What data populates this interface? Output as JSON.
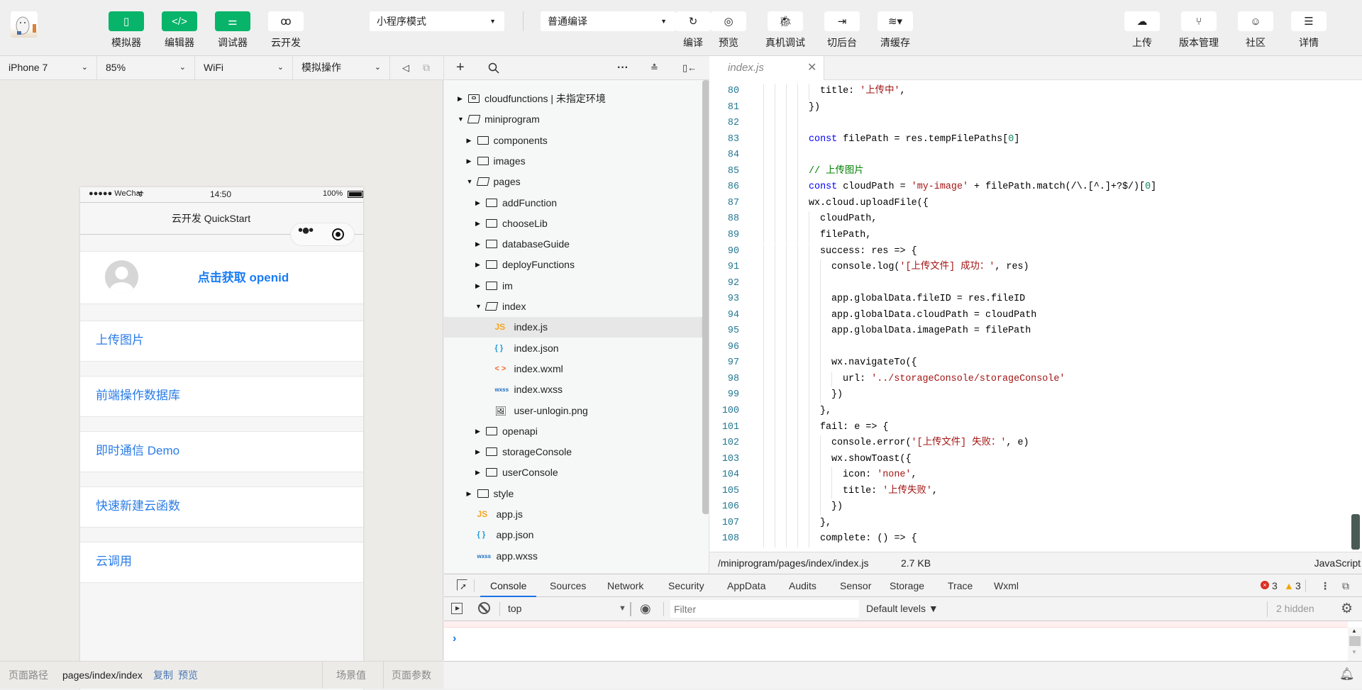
{
  "toolbar": {
    "left_buttons": [
      {
        "label": "模拟器",
        "icon": "phone-icon"
      },
      {
        "label": "编辑器",
        "icon": "code-icon"
      },
      {
        "label": "调试器",
        "icon": "debug-sliders-icon"
      },
      {
        "label": "云开发",
        "icon": "cloud-link-icon"
      }
    ],
    "mode_select": "小程序模式",
    "compile_select": "普通编译",
    "mid_buttons": [
      {
        "label": "编译",
        "icon": "refresh-icon"
      },
      {
        "label": "预览",
        "icon": "eye-icon"
      },
      {
        "label": "真机调试",
        "icon": "bug-icon"
      },
      {
        "label": "切后台",
        "icon": "switch-background-icon"
      },
      {
        "label": "清缓存",
        "icon": "layers-icon"
      }
    ],
    "right_buttons": [
      {
        "label": "上传",
        "icon": "cloud-upload-icon"
      },
      {
        "label": "版本管理",
        "icon": "branch-icon"
      },
      {
        "label": "社区",
        "icon": "chat-icon"
      },
      {
        "label": "详情",
        "icon": "menu-icon"
      }
    ],
    "accent_color": "#07b46a"
  },
  "simulator": {
    "device": "iPhone 7",
    "zoom": "85%",
    "network": "WiFi",
    "operation": "模拟操作",
    "phone": {
      "carrier": "●●●●● WeChat",
      "time": "14:50",
      "battery": "100%",
      "nav_title": "云开发 QuickStart",
      "openid_button": "点击获取 openid",
      "items": [
        "上传图片",
        "前端操作数据库",
        "即时通信 Demo",
        "快速新建云函数",
        "云调用"
      ],
      "link_color": "#2a7ce8"
    },
    "status": {
      "path_label": "页面路径",
      "path": "pages/index/index",
      "copy": "复制",
      "preview": "预览",
      "scene": "场景值",
      "params": "页面参数"
    }
  },
  "tree": [
    {
      "label": "cloudfunctions | 未指定环境",
      "depth": 0,
      "type": "cloud-folder",
      "arrow": "right"
    },
    {
      "label": "miniprogram",
      "depth": 0,
      "type": "folder-open",
      "arrow": "down"
    },
    {
      "label": "components",
      "depth": 1,
      "type": "folder",
      "arrow": "right"
    },
    {
      "label": "images",
      "depth": 1,
      "type": "folder",
      "arrow": "right"
    },
    {
      "label": "pages",
      "depth": 1,
      "type": "folder-open",
      "arrow": "down"
    },
    {
      "label": "addFunction",
      "depth": 2,
      "type": "folder",
      "arrow": "right"
    },
    {
      "label": "chooseLib",
      "depth": 2,
      "type": "folder",
      "arrow": "right"
    },
    {
      "label": "databaseGuide",
      "depth": 2,
      "type": "folder",
      "arrow": "right"
    },
    {
      "label": "deployFunctions",
      "depth": 2,
      "type": "folder",
      "arrow": "right"
    },
    {
      "label": "im",
      "depth": 2,
      "type": "folder",
      "arrow": "right"
    },
    {
      "label": "index",
      "depth": 2,
      "type": "folder-open",
      "arrow": "down"
    },
    {
      "label": "index.js",
      "depth": 3,
      "type": "js",
      "selected": true
    },
    {
      "label": "index.json",
      "depth": 3,
      "type": "json"
    },
    {
      "label": "index.wxml",
      "depth": 3,
      "type": "wxml"
    },
    {
      "label": "index.wxss",
      "depth": 3,
      "type": "wxss"
    },
    {
      "label": "user-unlogin.png",
      "depth": 3,
      "type": "image"
    },
    {
      "label": "openapi",
      "depth": 2,
      "type": "folder",
      "arrow": "right"
    },
    {
      "label": "storageConsole",
      "depth": 2,
      "type": "folder",
      "arrow": "right"
    },
    {
      "label": "userConsole",
      "depth": 2,
      "type": "folder",
      "arrow": "right"
    },
    {
      "label": "style",
      "depth": 1,
      "type": "folder",
      "arrow": "right"
    },
    {
      "label": "app.js",
      "depth": 1,
      "type": "js"
    },
    {
      "label": "app.json",
      "depth": 1,
      "type": "json"
    },
    {
      "label": "app.wxss",
      "depth": 1,
      "type": "wxss"
    }
  ],
  "editor": {
    "tab": "index.js",
    "lines": [
      {
        "n": 80,
        "indent": 12,
        "t": [
          [
            "p",
            "title: "
          ],
          [
            "s",
            "'上传中'"
          ],
          [
            "p",
            ","
          ]
        ]
      },
      {
        "n": 81,
        "indent": 10,
        "t": [
          [
            "p",
            "})"
          ]
        ]
      },
      {
        "n": 82,
        "indent": 10,
        "t": []
      },
      {
        "n": 83,
        "indent": 10,
        "t": [
          [
            "k",
            "const"
          ],
          [
            "p",
            " filePath = res.tempFilePaths["
          ],
          [
            "n",
            "0"
          ],
          [
            "p",
            "]"
          ]
        ]
      },
      {
        "n": 84,
        "indent": 10,
        "t": []
      },
      {
        "n": 85,
        "indent": 10,
        "t": [
          [
            "c",
            "// 上传图片"
          ]
        ]
      },
      {
        "n": 86,
        "indent": 10,
        "t": [
          [
            "k",
            "const"
          ],
          [
            "p",
            " cloudPath = "
          ],
          [
            "s",
            "'my-image'"
          ],
          [
            "p",
            " + filePath.match(/\\.[^.]+?$/)["
          ],
          [
            "n",
            "0"
          ],
          [
            "p",
            "]"
          ]
        ]
      },
      {
        "n": 87,
        "indent": 10,
        "t": [
          [
            "p",
            "wx.cloud.uploadFile({"
          ]
        ]
      },
      {
        "n": 88,
        "indent": 12,
        "t": [
          [
            "p",
            "cloudPath,"
          ]
        ]
      },
      {
        "n": 89,
        "indent": 12,
        "t": [
          [
            "p",
            "filePath,"
          ]
        ]
      },
      {
        "n": 90,
        "indent": 12,
        "t": [
          [
            "p",
            "success: res => {"
          ]
        ]
      },
      {
        "n": 91,
        "indent": 14,
        "t": [
          [
            "p",
            "console.log("
          ],
          [
            "s",
            "'[上传文件] 成功：'"
          ],
          [
            "p",
            ", res)"
          ]
        ]
      },
      {
        "n": 92,
        "indent": 14,
        "t": []
      },
      {
        "n": 93,
        "indent": 14,
        "t": [
          [
            "p",
            "app.globalData.fileID = res.fileID"
          ]
        ]
      },
      {
        "n": 94,
        "indent": 14,
        "t": [
          [
            "p",
            "app.globalData.cloudPath = cloudPath"
          ]
        ]
      },
      {
        "n": 95,
        "indent": 14,
        "t": [
          [
            "p",
            "app.globalData.imagePath = filePath"
          ]
        ]
      },
      {
        "n": 96,
        "indent": 14,
        "t": []
      },
      {
        "n": 97,
        "indent": 14,
        "t": [
          [
            "p",
            "wx.navigateTo({"
          ]
        ]
      },
      {
        "n": 98,
        "indent": 16,
        "t": [
          [
            "p",
            "url: "
          ],
          [
            "s",
            "'../storageConsole/storageConsole'"
          ]
        ]
      },
      {
        "n": 99,
        "indent": 14,
        "t": [
          [
            "p",
            "})"
          ]
        ]
      },
      {
        "n": 100,
        "indent": 12,
        "t": [
          [
            "p",
            "},"
          ]
        ]
      },
      {
        "n": 101,
        "indent": 12,
        "t": [
          [
            "p",
            "fail: e => {"
          ]
        ]
      },
      {
        "n": 102,
        "indent": 14,
        "t": [
          [
            "p",
            "console.error("
          ],
          [
            "s",
            "'[上传文件] 失败：'"
          ],
          [
            "p",
            ", e)"
          ]
        ]
      },
      {
        "n": 103,
        "indent": 14,
        "t": [
          [
            "p",
            "wx.showToast({"
          ]
        ]
      },
      {
        "n": 104,
        "indent": 16,
        "t": [
          [
            "p",
            "icon: "
          ],
          [
            "s",
            "'none'"
          ],
          [
            "p",
            ","
          ]
        ]
      },
      {
        "n": 105,
        "indent": 16,
        "t": [
          [
            "p",
            "title: "
          ],
          [
            "s",
            "'上传失败'"
          ],
          [
            "p",
            ","
          ]
        ]
      },
      {
        "n": 106,
        "indent": 14,
        "t": [
          [
            "p",
            "})"
          ]
        ]
      },
      {
        "n": 107,
        "indent": 12,
        "t": [
          [
            "p",
            "},"
          ]
        ]
      },
      {
        "n": 108,
        "indent": 12,
        "t": [
          [
            "p",
            "complete: () => {"
          ]
        ]
      }
    ],
    "status": {
      "path": "/miniprogram/pages/index/index.js",
      "size": "2.7 KB",
      "language": "JavaScript"
    }
  },
  "devtools": {
    "tabs": [
      "Console",
      "Sources",
      "Network",
      "Security",
      "AppData",
      "Audits",
      "Sensor",
      "Storage",
      "Trace",
      "Wxml"
    ],
    "active_tab": "Console",
    "errors": "3",
    "warnings": "3",
    "context": "top",
    "filter_placeholder": "Filter",
    "levels": "Default levels ▼",
    "hidden": "2 hidden",
    "prompt": "›"
  }
}
